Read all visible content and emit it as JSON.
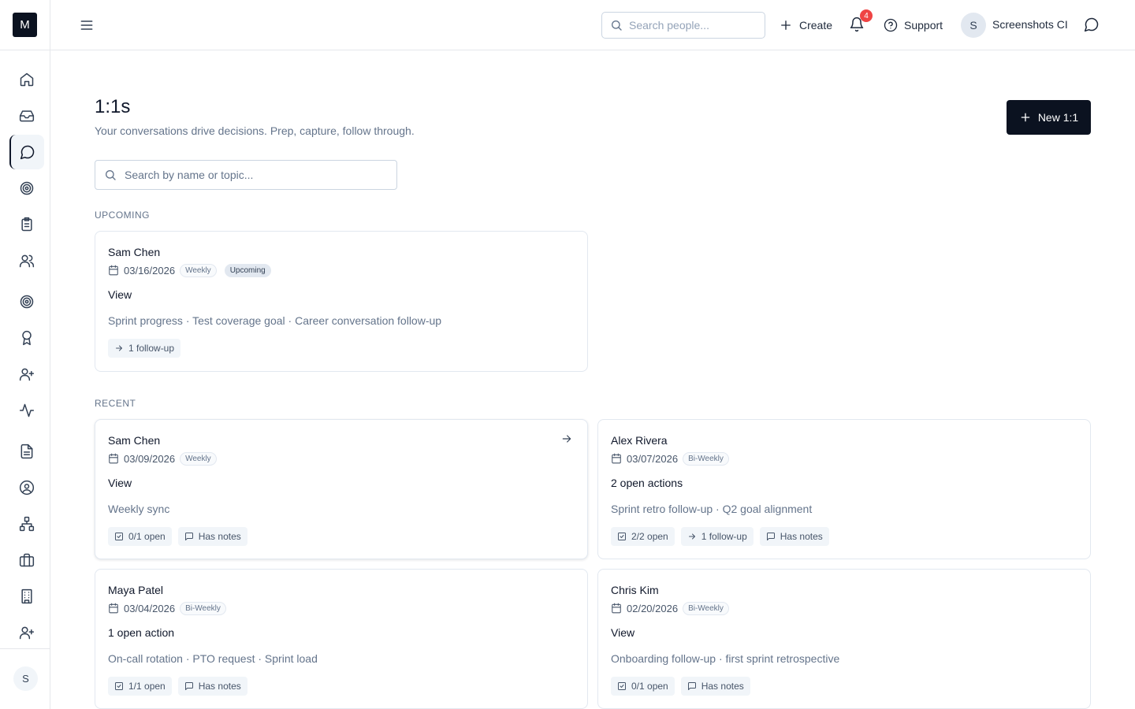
{
  "app": {
    "logo_letter": "M"
  },
  "sidebar": {
    "items": [
      {
        "icon": "home-icon"
      },
      {
        "icon": "inbox-icon"
      },
      {
        "icon": "chat-bubble-icon",
        "active": true
      },
      {
        "icon": "target-icon"
      },
      {
        "icon": "clipboard-checklist-icon"
      },
      {
        "icon": "users-icon"
      },
      {
        "icon": "goal-target-icon"
      },
      {
        "icon": "award-icon"
      },
      {
        "icon": "user-plus-icon"
      },
      {
        "icon": "activity-icon"
      },
      {
        "icon": "document-icon"
      },
      {
        "icon": "user-circle-icon"
      },
      {
        "icon": "org-chart-icon"
      },
      {
        "icon": "briefcase-icon"
      },
      {
        "icon": "building-icon"
      },
      {
        "icon": "user-add-icon"
      }
    ],
    "user_initial": "S"
  },
  "header": {
    "search_placeholder": "Search people...",
    "create_label": "Create",
    "notification_count": "4",
    "support_label": "Support",
    "user_initial": "S",
    "user_name": "Screenshots CI"
  },
  "main": {
    "title": "1:1s",
    "subtitle": "Your conversations drive decisions. Prep, capture, follow through.",
    "new_button_label": "New 1:1",
    "search_placeholder": "Search by name or topic...",
    "upcoming_label": "UPCOMING",
    "recent_label": "RECENT",
    "upcoming": [
      {
        "name": "Sam Chen",
        "date": "03/16/2026",
        "cadence": "Weekly",
        "status": "Upcoming",
        "headline": "View",
        "topics": "Sprint progress · Test coverage goal · Career conversation follow-up",
        "tags": [
          {
            "icon": "arrow-right-icon",
            "label": "1 follow-up"
          }
        ]
      }
    ],
    "recent": [
      {
        "name": "Sam Chen",
        "date": "03/09/2026",
        "cadence": "Weekly",
        "headline": "View",
        "topics": "Weekly sync",
        "tags": [
          {
            "icon": "checkbox-icon",
            "label": "0/1 open"
          },
          {
            "icon": "message-icon",
            "label": "Has notes"
          }
        ]
      },
      {
        "name": "Alex Rivera",
        "date": "03/07/2026",
        "cadence": "Bi-Weekly",
        "headline": "2 open actions",
        "topics": "Sprint retro follow-up · Q2 goal alignment",
        "tags": [
          {
            "icon": "checkbox-icon",
            "label": "2/2 open"
          },
          {
            "icon": "arrow-right-icon",
            "label": "1 follow-up"
          },
          {
            "icon": "message-icon",
            "label": "Has notes"
          }
        ]
      },
      {
        "name": "Maya Patel",
        "date": "03/04/2026",
        "cadence": "Bi-Weekly",
        "headline": "1 open action",
        "topics": "On-call rotation · PTO request · Sprint load",
        "tags": [
          {
            "icon": "checkbox-icon",
            "label": "1/1 open"
          },
          {
            "icon": "message-icon",
            "label": "Has notes"
          }
        ]
      },
      {
        "name": "Chris Kim",
        "date": "02/20/2026",
        "cadence": "Bi-Weekly",
        "headline": "View",
        "topics": "Onboarding follow-up · first sprint retrospective",
        "tags": [
          {
            "icon": "checkbox-icon",
            "label": "0/1 open"
          },
          {
            "icon": "message-icon",
            "label": "Has notes"
          }
        ]
      }
    ]
  }
}
